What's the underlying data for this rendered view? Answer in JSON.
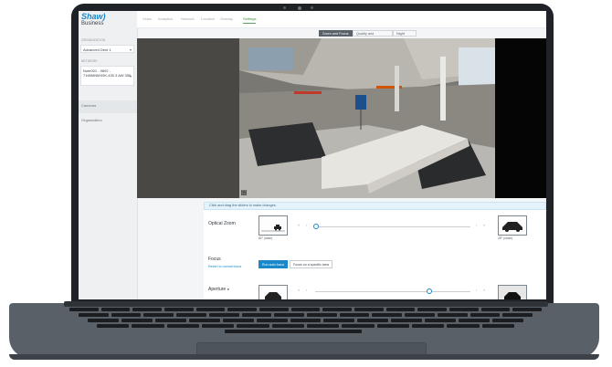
{
  "brand": {
    "name": "Shaw)",
    "sub": "Business"
  },
  "sidebar": {
    "org_label": "ORGANIZATION",
    "org_value": "Advanced Dent 1",
    "network_label": "NETWORK",
    "network_value": "Note001 - 9892 - 7165MNMX9K-430 3 AW 356",
    "items": [
      {
        "label": "Cameras"
      },
      {
        "label": "Organization"
      }
    ]
  },
  "topnav": {
    "tabs": [
      {
        "label": "Video"
      },
      {
        "label": "Analytics"
      },
      {
        "label": "Network"
      },
      {
        "label": "Location"
      },
      {
        "label": "Overlay"
      },
      {
        "label": "Settings",
        "active": true
      }
    ]
  },
  "subtabs": [
    {
      "label": "Zoom and Focus",
      "active": true
    },
    {
      "label": "Quality and Retention"
    },
    {
      "label": "Night Mode"
    }
  ],
  "hint": "Click and drag the sliders to make changes.",
  "optical_zoom": {
    "label": "Optical Zoom",
    "min_caption": "82° (wide)",
    "max_caption": "28° (close)",
    "level": 0.0
  },
  "focus": {
    "label": "Focus",
    "link": "Revert to normal focus",
    "primary_button": "Run auto focus",
    "secondary_button": "Focus on a specific area"
  },
  "aperture": {
    "label": "Aperture",
    "info_icon": "info-icon",
    "level": 0.73
  },
  "accent_color": "#1a87c9"
}
